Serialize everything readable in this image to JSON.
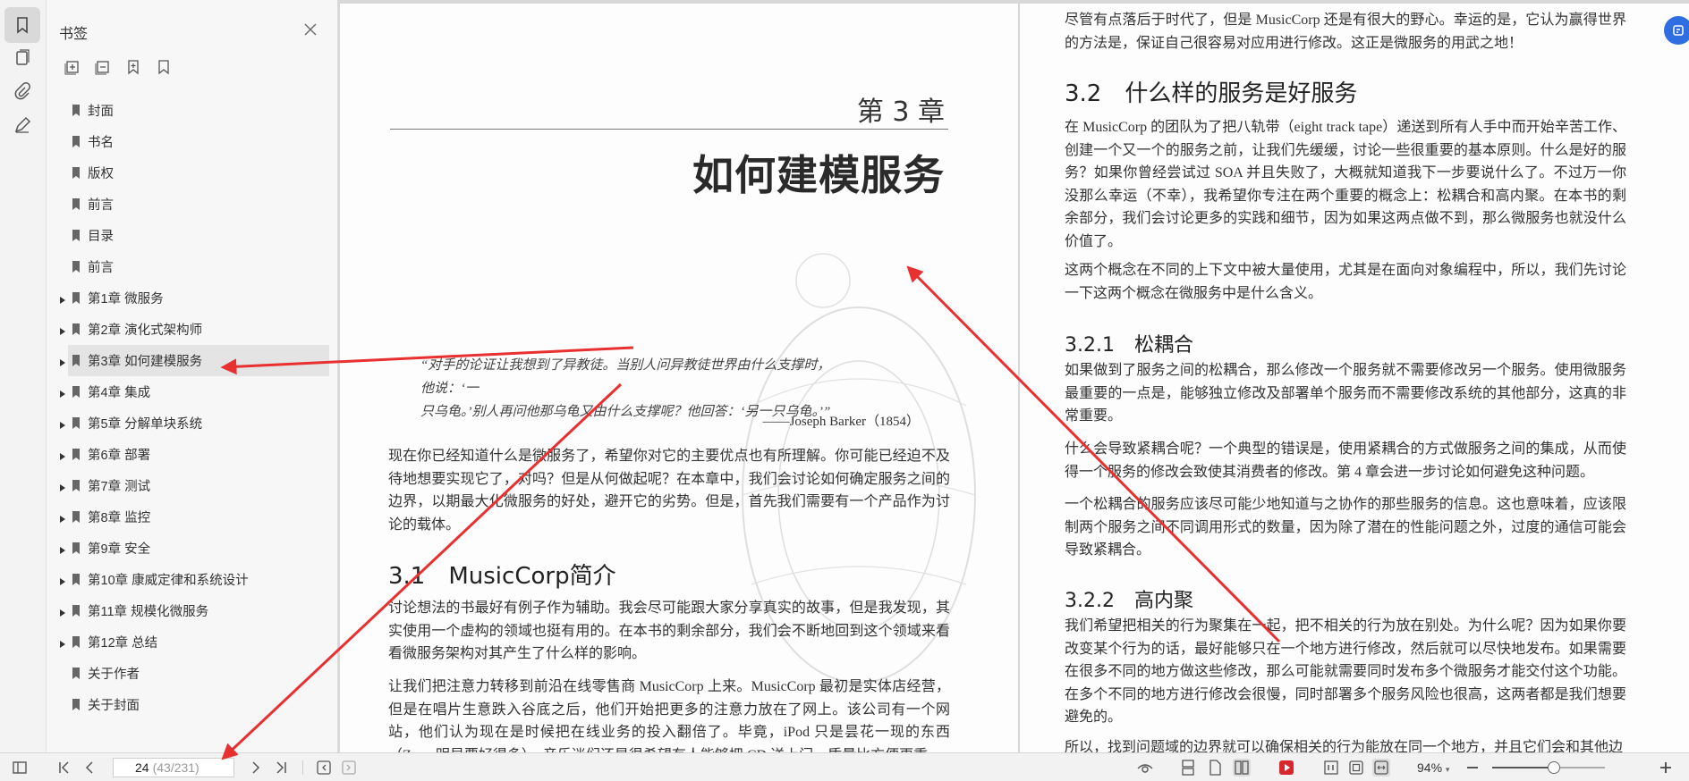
{
  "sidebar": {
    "title": "书签",
    "items": [
      {
        "label": "封面",
        "expandable": false
      },
      {
        "label": "书名",
        "expandable": false
      },
      {
        "label": "版权",
        "expandable": false
      },
      {
        "label": "前言",
        "expandable": false
      },
      {
        "label": "目录",
        "expandable": false
      },
      {
        "label": "前言",
        "expandable": false
      },
      {
        "label": "第1章 微服务",
        "expandable": true
      },
      {
        "label": "第2章 演化式架构师",
        "expandable": true
      },
      {
        "label": "第3章 如何建模服务",
        "expandable": true,
        "selected": true
      },
      {
        "label": "第4章 集成",
        "expandable": true
      },
      {
        "label": "第5章 分解单块系统",
        "expandable": true
      },
      {
        "label": "第6章 部署",
        "expandable": true
      },
      {
        "label": "第7章 测试",
        "expandable": true
      },
      {
        "label": "第8章 监控",
        "expandable": true
      },
      {
        "label": "第9章 安全",
        "expandable": true
      },
      {
        "label": "第10章 康威定律和系统设计",
        "expandable": true
      },
      {
        "label": "第11章 规模化微服务",
        "expandable": true
      },
      {
        "label": "第12章 总结",
        "expandable": true
      },
      {
        "label": "关于作者",
        "expandable": false
      },
      {
        "label": "关于封面",
        "expandable": false
      }
    ]
  },
  "left_page": {
    "chapter_number": "第 3 章",
    "chapter_title": "如何建模服务",
    "quote_line1": "“对手的论证让我想到了异教徒。当别人问异教徒世界由什么支撑时，他说：‘一",
    "quote_line2": "只乌龟。’别人再问他那乌龟又由什么支撑呢？他回答：‘另一只乌龟。’”",
    "quote_source": "——Joseph Barker（1854）",
    "intro": "现在你已经知道什么是微服务了，希望你对它的主要优点也有所理解。你可能已经迫不及待地想要实现它了，对吗？但是从何做起呢？在本章中，我们会讨论如何确定服务之间的边界，以期最大化微服务的好处，避开它的劣势。但是，首先我们需要有一个产品作为讨论的载体。",
    "section_heading": "3.1　MusicCorp简介",
    "section_para1": "讨论想法的书最好有例子作为辅助。我会尽可能跟大家分享真实的故事，但是我发现，其实使用一个虚构的领域也挺有用的。在本书的剩余部分，我们会不断地回到这个领域来看看微服务架构对其产生了什么样的影响。",
    "section_para2": "让我们把注意力转移到前沿在线零售商 MusicCorp 上来。MusicCorp 最初是实体店经营，但是在唱片生意跌入谷底之后，他们开始把更多的注意力放在了网上。该公司有一个网站，他们认为现在是时候把在线业务的投入翻倍了。毕竟，iPod 只是昙花一现的东西（Zune 明显要好得多），音乐迷们还是很希望有人能够把 CD 送上门。质量比方便更重"
  },
  "right_page": {
    "top_para": "尽管有点落后于时代了，但是 MusicCorp 还是有很大的野心。幸运的是，它认为赢得世界的方法是，保证自己很容易对应用进行修改。这正是微服务的用武之地！",
    "h32": "3.2　什么样的服务是好服务",
    "p32a": "在 MusicCorp 的团队为了把八轨带（eight track tape）递送到所有人手中而开始辛苦工作、创建一个又一个的服务之前，让我们先缓缓，讨论一些很重要的基本原则。什么是好的服务？如果你曾经尝试过 SOA 并且失败了，大概就知道我下一步要说什么了。不过万一你没那么幸运（不幸），我希望你专注在两个重要的概念上：松耦合和高内聚。在本书的剩余部分，我们会讨论更多的实践和细节，因为如果这两点做不到，那么微服务也就没什么价值了。",
    "p32b": "这两个概念在不同的上下文中被大量使用，尤其是在面向对象编程中，所以，我们先讨论一下这两个概念在微服务中是什么含义。",
    "h321": "3.2.1　松耦合",
    "p321a": "如果做到了服务之间的松耦合，那么修改一个服务就不需要修改另一个服务。使用微服务最重要的一点是，能够独立修改及部署单个服务而不需要修改系统的其他部分，这真的非常重要。",
    "p321b": "什么会导致紧耦合呢？一个典型的错误是，使用紧耦合的方式做服务之间的集成，从而使得一个服务的修改会致使其消费者的修改。第 4 章会进一步讨论如何避免这种问题。",
    "p321c": "一个松耦合的服务应该尽可能少地知道与之协作的那些服务的信息。这也意味着，应该限制两个服务之间不同调用形式的数量，因为除了潜在的性能问题之外，过度的通信可能会导致紧耦合。",
    "h322": "3.2.2　高内聚",
    "p322a": "我们希望把相关的行为聚集在一起，把不相关的行为放在别处。为什么呢？因为如果你要改变某个行为的话，最好能够只在一个地方进行修改，然后就可以尽快地发布。如果需要在很多不同的地方做这些修改，那么可能就需要同时发布多个微服务才能交付这个功能。在多个不同的地方进行修改会很慢，同时部署多个服务风险也很高，这两者都是我们想要避免的。",
    "p322b": "所以，找到问题域的边界就可以确保相关的行为能放在同一个地方，并且它们会和其他边"
  },
  "statusbar": {
    "page_current": "24",
    "page_total": "(43/231)",
    "zoom": "94%",
    "zoom_level": 0.55
  },
  "colors": {
    "accent": "#2f6ee0",
    "arrow": "#e83030",
    "record": "#d9272e"
  }
}
